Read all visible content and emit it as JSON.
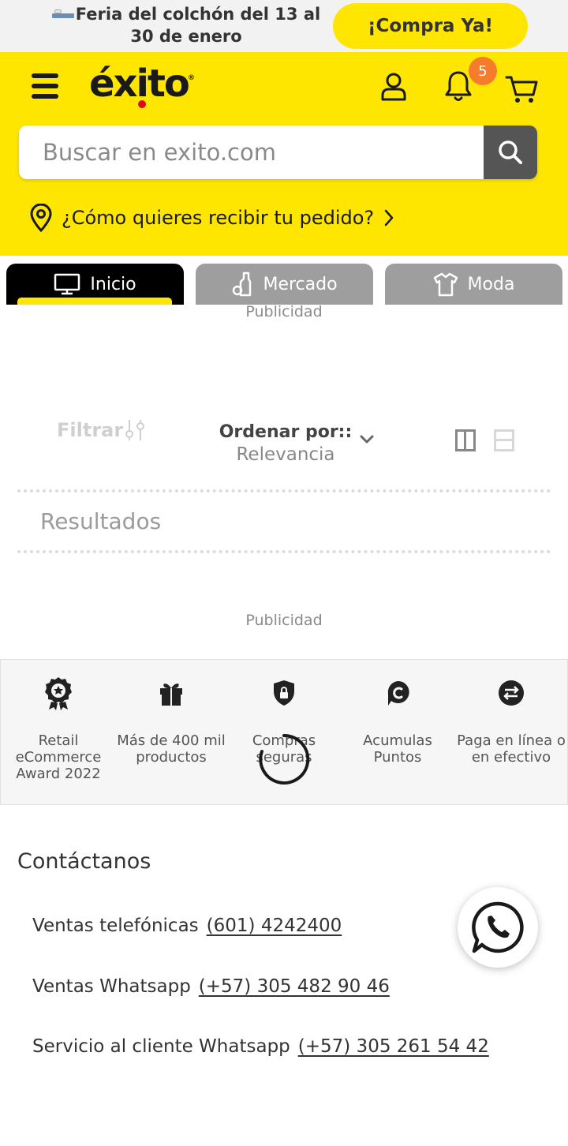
{
  "promo": {
    "text": "Feria del colchón del 13 al 30 de enero",
    "button_label": "¡Compra Ya!"
  },
  "header": {
    "logo_text": "éxito",
    "logo_mark": "®",
    "notifications_count": "5",
    "search_placeholder": "Buscar en exito.com",
    "delivery_label": "¿Cómo quieres recibir tu pedido?"
  },
  "tabs": [
    {
      "label": "Inicio",
      "icon": "monitor-icon",
      "active": true
    },
    {
      "label": "Mercado",
      "icon": "bottle-icon",
      "active": false
    },
    {
      "label": "Moda",
      "icon": "shirt-icon",
      "active": false
    }
  ],
  "ads": {
    "top_label": "Publicidad",
    "bottom_label": "Publicidad"
  },
  "toolbar": {
    "filter_label": "Filtrar",
    "sort_title": "Ordenar por::",
    "sort_value": "Relevancia"
  },
  "results_label": "Resultados",
  "benefits": [
    {
      "label": "Retail eCommerce Award 2022",
      "icon": "award-icon"
    },
    {
      "label": "Más de 400 mil productos",
      "icon": "gift-icon"
    },
    {
      "label": "Compras seguras",
      "icon": "shield-lock-icon"
    },
    {
      "label": "Acumulas Puntos",
      "icon": "points-icon"
    },
    {
      "label": "Paga en línea o en efectivo",
      "icon": "exchange-icon"
    }
  ],
  "contact": {
    "title": "Contáctanos",
    "rows": [
      {
        "label": "Ventas telefónicas",
        "value": "(601) 4242400"
      },
      {
        "label": "Ventas Whatsapp",
        "value": "(+57) 305 482 90 46"
      },
      {
        "label": "Servicio al cliente Whatsapp",
        "value": "(+57) 305 261 54 42"
      }
    ]
  },
  "colors": {
    "brand_yellow": "#ffe600",
    "badge_orange": "#f57c2c",
    "logo_red": "#e30613"
  }
}
